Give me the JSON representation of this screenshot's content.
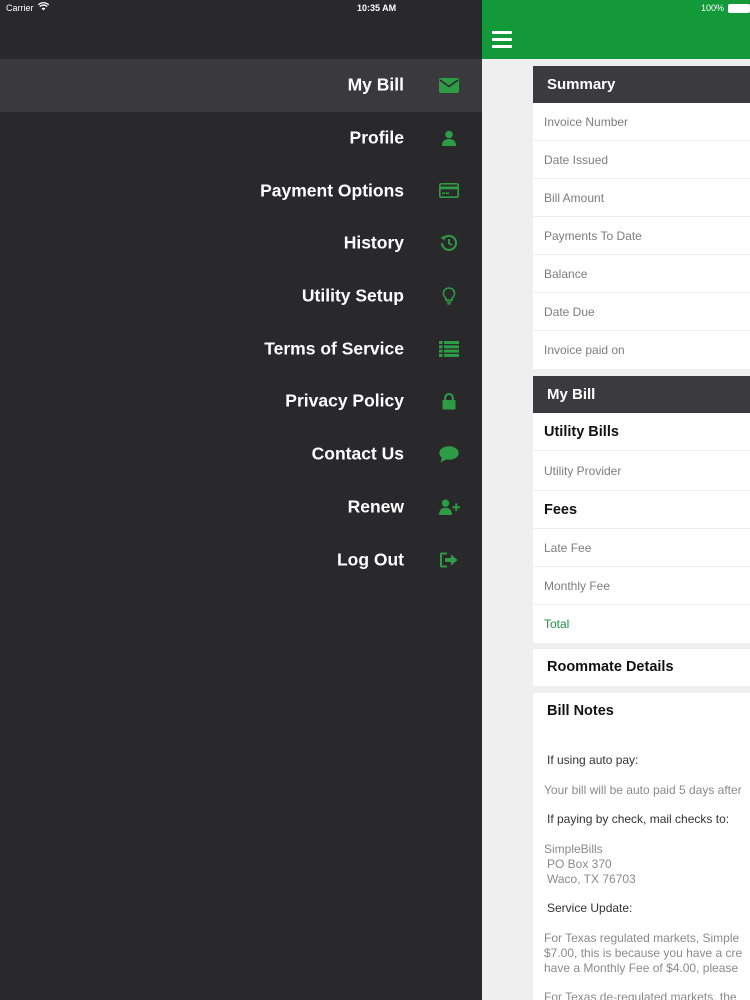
{
  "status": {
    "carrier": "Carrier",
    "time": "10:35 AM",
    "battery": "100%"
  },
  "menu": {
    "items": [
      {
        "label": "My Bill",
        "icon": "envelope-icon"
      },
      {
        "label": "Profile",
        "icon": "user-icon"
      },
      {
        "label": "Payment Options",
        "icon": "credit-card-icon"
      },
      {
        "label": "History",
        "icon": "history-icon"
      },
      {
        "label": "Utility Setup",
        "icon": "lightbulb-icon"
      },
      {
        "label": "Terms of Service",
        "icon": "list-icon"
      },
      {
        "label": "Privacy Policy",
        "icon": "lock-icon"
      },
      {
        "label": "Contact Us",
        "icon": "chat-bubble-icon"
      },
      {
        "label": "Renew",
        "icon": "add-user-icon"
      },
      {
        "label": "Log Out",
        "icon": "sign-out-icon"
      }
    ],
    "icon_color": "#2e9b45",
    "active_item": "My Bill"
  },
  "summary": {
    "title": "Summary",
    "rows": [
      "Invoice Number",
      "Date Issued",
      "Bill Amount",
      "Payments To Date",
      "Balance",
      "Date Due",
      "Invoice paid on"
    ]
  },
  "mybill": {
    "title": "My Bill",
    "utility_heading": "Utility Bills",
    "utility_provider": "Utility Provider",
    "fees_heading": "Fees",
    "late_fee": "Late Fee",
    "monthly_fee": "Monthly Fee",
    "total": "Total"
  },
  "roommate": {
    "title": "Roommate Details"
  },
  "notes": {
    "title": "Bill Notes",
    "autopay_heading": "If using auto pay:",
    "autopay_text": "Your bill will be auto paid 5 days after",
    "check_heading": "If paying by check, mail checks to:",
    "address_1": "SimpleBills",
    "address_2": "PO Box 370",
    "address_3": "Waco, TX 76703",
    "service_heading": "Service Update:",
    "service_line_1": "For Texas regulated markets, Simple",
    "service_line_2": "$7.00, this is because you have a cre",
    "service_line_3": "have a Monthly Fee of $4.00, please",
    "service_line_4": "For Texas de-regulated markets, the"
  },
  "colors": {
    "brand_green": "#13983a",
    "header_dark": "#3b3b3d",
    "menu_bg": "#29292b"
  }
}
